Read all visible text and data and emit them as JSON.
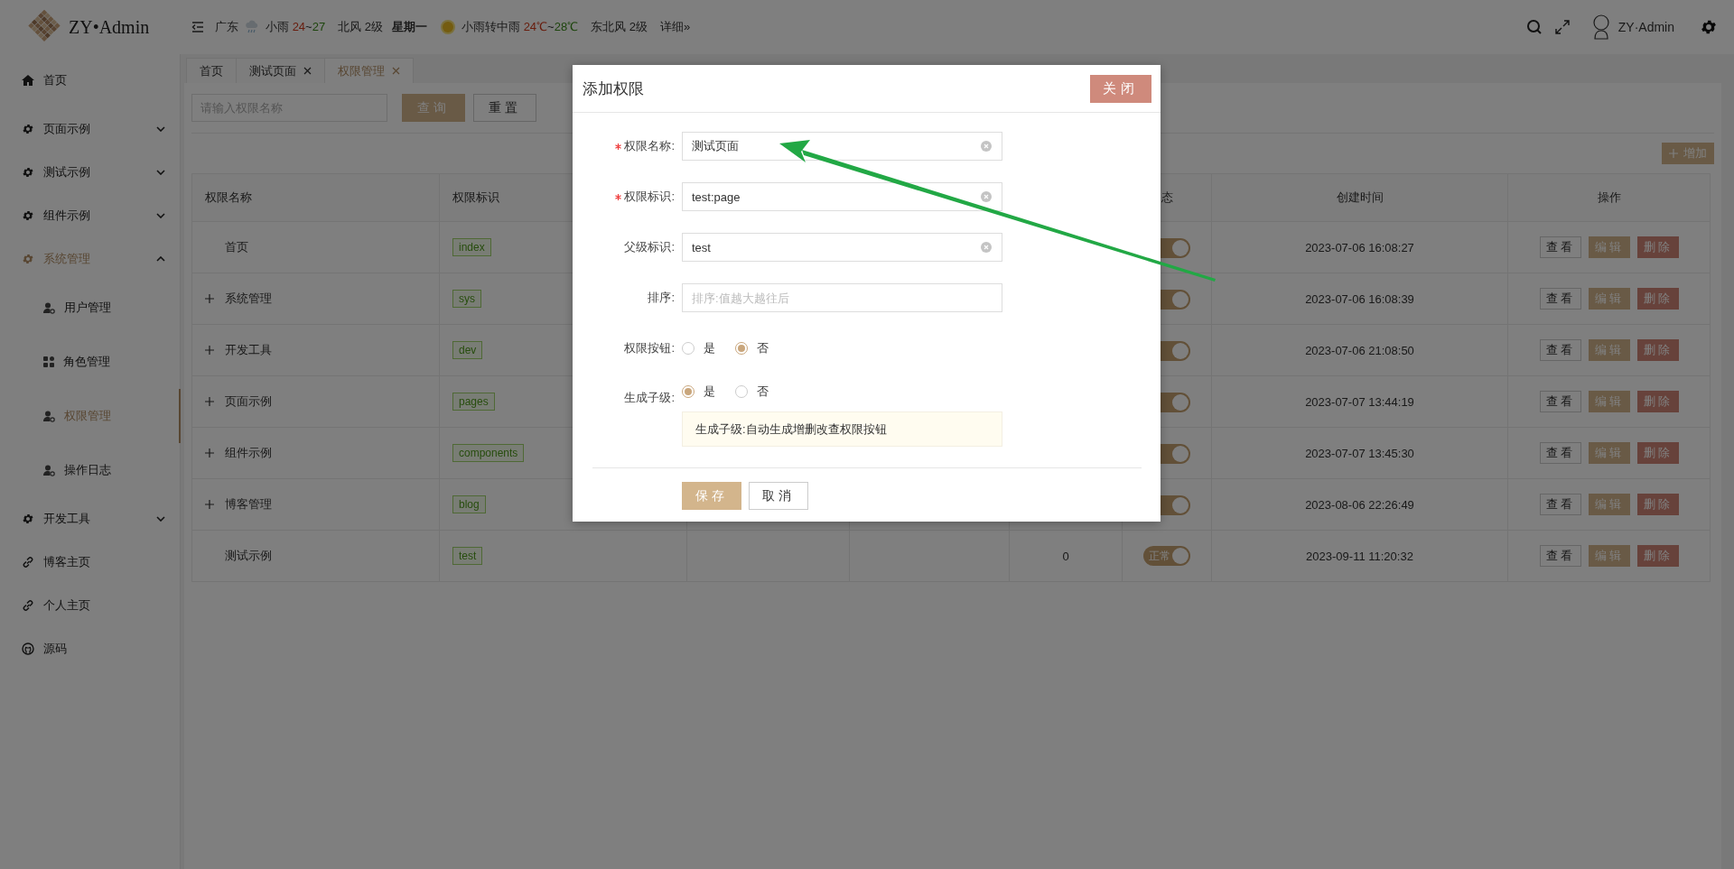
{
  "header": {
    "logo": "ZY•Admin",
    "weather": {
      "city": "广东",
      "days": [
        {
          "kind": "rain",
          "condition": "小雨",
          "low": "24",
          "sep": "~",
          "high": "27",
          "wind": "北风 2级",
          "weekday": "星期一"
        },
        {
          "kind": "sun",
          "condition": "小雨转中雨",
          "low": "24℃",
          "sep": "~",
          "high": "28℃",
          "wind": "东北风 2级"
        }
      ],
      "more": "详细»"
    },
    "user": "ZY·Admin"
  },
  "sidebar": {
    "items": [
      {
        "kind": "home",
        "label": "首页",
        "selected": false
      },
      {
        "kind": "gear",
        "label": "页面示例",
        "selected": false,
        "expanded": false
      },
      {
        "kind": "gear",
        "label": "测试示例",
        "selected": false,
        "expanded": false
      },
      {
        "kind": "gear",
        "label": "组件示例",
        "selected": false,
        "expanded": false
      },
      {
        "kind": "gear",
        "label": "系统管理",
        "selected": true,
        "expanded": true,
        "children": [
          {
            "kind": "user",
            "label": "用户管理",
            "selected": false
          },
          {
            "kind": "grid",
            "label": "角色管理",
            "selected": false
          },
          {
            "kind": "user",
            "label": "权限管理",
            "selected": true
          },
          {
            "kind": "user",
            "label": "操作日志",
            "selected": false
          }
        ]
      },
      {
        "kind": "gear",
        "label": "开发工具",
        "selected": false,
        "expanded": false
      },
      {
        "kind": "link",
        "label": "博客主页",
        "selected": false
      },
      {
        "kind": "link",
        "label": "个人主页",
        "selected": false
      },
      {
        "kind": "github",
        "label": "源码",
        "selected": false
      }
    ]
  },
  "tabs": [
    {
      "label": "首页",
      "closable": false,
      "selected": false
    },
    {
      "label": "测试页面",
      "closable": true,
      "selected": false
    },
    {
      "label": "权限管理",
      "closable": true,
      "selected": true
    }
  ],
  "search": {
    "placeholder": "请输入权限名称",
    "buttons": [
      {
        "kind": "primary",
        "label": "查询"
      },
      {
        "kind": "default",
        "label": "重置"
      }
    ]
  },
  "add_button": "增加",
  "table": {
    "columns": [
      {
        "label": "权限名称"
      },
      {
        "label": "权限标识"
      },
      {
        "label": "态"
      },
      {
        "label": "创建时间"
      },
      {
        "label": "操作"
      }
    ],
    "rows": [
      {
        "name": "首页",
        "expandable": false,
        "tag": "index",
        "status": {
          "on": true
        },
        "created": "2023-07-06 16:08:27",
        "actions": [
          {
            "kind": "view",
            "label": "查看"
          },
          {
            "kind": "edit",
            "label": "编辑"
          },
          {
            "kind": "delete",
            "label": "删除"
          }
        ]
      },
      {
        "name": "系统管理",
        "expandable": true,
        "tag": "sys",
        "status": {
          "on": true
        },
        "created": "2023-07-06 16:08:39",
        "actions": [
          {
            "kind": "view",
            "label": "查看"
          },
          {
            "kind": "edit",
            "label": "编辑"
          },
          {
            "kind": "delete",
            "label": "删除"
          }
        ]
      },
      {
        "name": "开发工具",
        "expandable": true,
        "tag": "dev",
        "status": {
          "on": true
        },
        "created": "2023-07-06 21:08:50",
        "actions": [
          {
            "kind": "view",
            "label": "查看"
          },
          {
            "kind": "edit",
            "label": "编辑"
          },
          {
            "kind": "delete",
            "label": "删除"
          }
        ]
      },
      {
        "name": "页面示例",
        "expandable": true,
        "tag": "pages",
        "status": {
          "on": true
        },
        "created": "2023-07-07 13:44:19",
        "actions": [
          {
            "kind": "view",
            "label": "查看"
          },
          {
            "kind": "edit",
            "label": "编辑"
          },
          {
            "kind": "delete",
            "label": "删除"
          }
        ]
      },
      {
        "name": "组件示例",
        "expandable": true,
        "tag": "components",
        "status": {
          "on": true
        },
        "created": "2023-07-07 13:45:30",
        "actions": [
          {
            "kind": "view",
            "label": "查看"
          },
          {
            "kind": "edit",
            "label": "编辑"
          },
          {
            "kind": "delete",
            "label": "删除"
          }
        ]
      },
      {
        "name": "博客管理",
        "expandable": true,
        "tag": "blog",
        "status": {
          "on": true
        },
        "created": "2023-08-06 22:26:49",
        "actions": [
          {
            "kind": "view",
            "label": "查看"
          },
          {
            "kind": "edit",
            "label": "编辑"
          },
          {
            "kind": "delete",
            "label": "删除"
          }
        ]
      },
      {
        "name": "测试示例",
        "expandable": false,
        "tag": "test",
        "column_5": "0",
        "status": {
          "on": true,
          "label": "正常"
        },
        "created": "2023-09-11 11:20:32",
        "actions": [
          {
            "kind": "view",
            "label": "查看"
          },
          {
            "kind": "edit",
            "label": "编辑"
          },
          {
            "kind": "delete",
            "label": "删除"
          }
        ]
      }
    ]
  },
  "modal": {
    "title": "添加权限",
    "close": "关闭",
    "fields": [
      {
        "kind": "input",
        "label": "权限名称:",
        "required": true,
        "value": "测试页面",
        "clearable": true
      },
      {
        "kind": "input",
        "label": "权限标识:",
        "required": true,
        "value": "test:page",
        "clearable": true
      },
      {
        "kind": "input",
        "label": "父级标识:",
        "required": false,
        "value": "test",
        "clearable": true
      },
      {
        "kind": "input",
        "label": "排序:",
        "required": false,
        "placeholder": "排序:值越大越往后",
        "clearable": false
      },
      {
        "kind": "radio",
        "label": "权限按钮:",
        "required": false,
        "options": [
          {
            "label": "是",
            "selected": false
          },
          {
            "label": "否",
            "selected": true
          }
        ]
      },
      {
        "kind": "radio",
        "label": "生成子级:",
        "required": false,
        "options": [
          {
            "label": "是",
            "selected": true
          },
          {
            "label": "否",
            "selected": false
          }
        ],
        "note": "生成子级:自动生成增删改查权限按钮"
      }
    ],
    "buttons": [
      {
        "kind": "primary",
        "label": "保存"
      },
      {
        "kind": "default",
        "label": "取消"
      }
    ]
  }
}
